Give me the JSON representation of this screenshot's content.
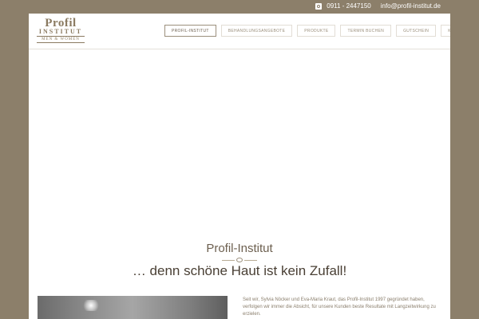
{
  "topbar": {
    "phone_icon": "phone-icon",
    "phone": "0911 - 2447150",
    "email": "info@profil-institut.de"
  },
  "logo": {
    "line1": "Profil",
    "line2": "INSTITUT",
    "line3": "MEN & WOMEN"
  },
  "nav": {
    "items": [
      {
        "label": "PROFIL-INSTITUT",
        "active": true
      },
      {
        "label": "BEHANDLUNGSANGEBOTE",
        "active": false
      },
      {
        "label": "PRODUKTE",
        "active": false
      },
      {
        "label": "TERMIN BUCHEN",
        "active": false
      },
      {
        "label": "GUTSCHEIN",
        "active": false
      },
      {
        "label": "KONTAKT",
        "active": false
      }
    ]
  },
  "hero": {
    "title": "Profil-Institut",
    "tagline": "… denn schöne Haut ist kein Zufall!"
  },
  "about": {
    "text": "Seit wir, Sylvia Nöcker und Eva-Maria Kraut, das Profil-Institut 1997 gegründet haben, verfolgen wir immer die Absicht, für unsere Kunden beste Resultate mit Langzeitwirkung zu erzielen."
  },
  "colors": {
    "background": "#8c7f6a",
    "accent": "#9b8f7c"
  }
}
